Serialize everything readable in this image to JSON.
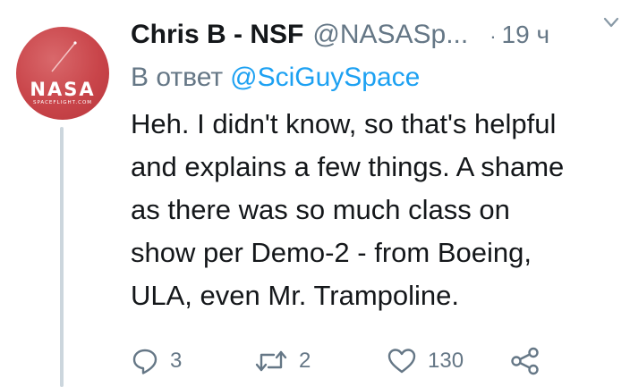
{
  "author": {
    "avatar": {
      "logo": "NASA",
      "subtitle": "SPACEFLIGHT.COM",
      "color": "#c9454a"
    },
    "display_name": "Chris B - NSF",
    "handle": "@NASASp...",
    "separator": "·",
    "time": "19 ч"
  },
  "reply": {
    "prefix": "В ответ",
    "mention": "@SciGuySpace"
  },
  "tweet": {
    "lines": [
      "Heh. I didn't know, so that's helpful",
      "and explains a few things. A shame",
      "as there was so much class on",
      "show per Demo-2 - from Boeing,",
      "ULA, even Mr. Trampoline."
    ]
  },
  "actions": {
    "reply": {
      "icon": "reply-icon",
      "count": "3"
    },
    "retweet": {
      "icon": "retweet-icon",
      "count": "2"
    },
    "like": {
      "icon": "heart-icon",
      "count": "130"
    },
    "share": {
      "icon": "share-icon"
    }
  },
  "colors": {
    "text": "#14171a",
    "muted": "#657786",
    "link": "#1da1f2",
    "thread_line": "#ccd6dd"
  }
}
